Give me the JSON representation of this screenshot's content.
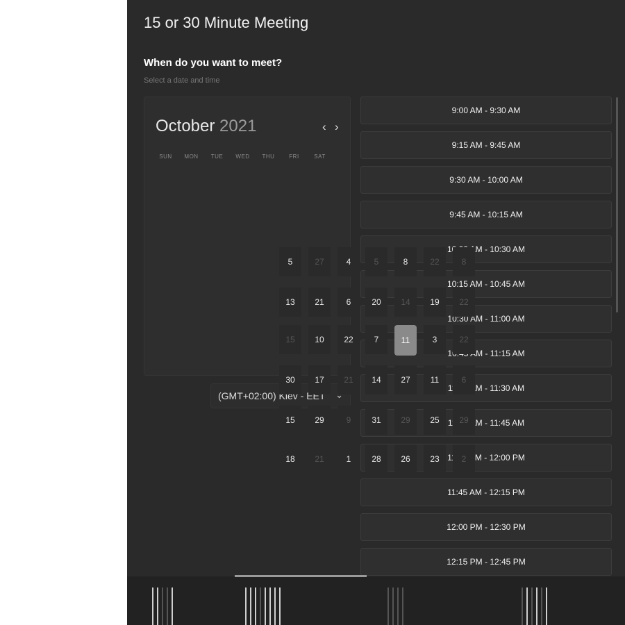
{
  "meeting": {
    "title": "15 or 30 Minute Meeting",
    "heading": "When do you want to meet?",
    "subheading": "Select a date and time"
  },
  "calendar": {
    "month": "October",
    "year": "2021",
    "prev_icon": "‹",
    "next_icon": "›",
    "weekdays": [
      "SUN",
      "MON",
      "TUE",
      "WED",
      "THU",
      "FRI",
      "SAT"
    ],
    "days": [
      {
        "label": "5",
        "dim": false
      },
      {
        "label": "27",
        "dim": true
      },
      {
        "label": "4",
        "dim": false
      },
      {
        "label": "5",
        "dim": true
      },
      {
        "label": "8",
        "dim": false
      },
      {
        "label": "22",
        "dim": true
      },
      {
        "label": "8",
        "dim": true
      },
      {
        "label": "13",
        "dim": false
      },
      {
        "label": "21",
        "dim": false
      },
      {
        "label": "6",
        "dim": false
      },
      {
        "label": "20",
        "dim": false
      },
      {
        "label": "14",
        "dim": true
      },
      {
        "label": "19",
        "dim": false
      },
      {
        "label": "22",
        "dim": true
      },
      {
        "label": "15",
        "dim": true
      },
      {
        "label": "10",
        "dim": false
      },
      {
        "label": "22",
        "dim": false
      },
      {
        "label": "7",
        "dim": false
      },
      {
        "label": "11",
        "dim": false,
        "selected": true
      },
      {
        "label": "3",
        "dim": false
      },
      {
        "label": "22",
        "dim": true
      },
      {
        "label": "30",
        "dim": false
      },
      {
        "label": "17",
        "dim": false
      },
      {
        "label": "21",
        "dim": true
      },
      {
        "label": "14",
        "dim": false
      },
      {
        "label": "27",
        "dim": false
      },
      {
        "label": "11",
        "dim": false
      },
      {
        "label": "6",
        "dim": true
      },
      {
        "label": "15",
        "dim": false
      },
      {
        "label": "29",
        "dim": false
      },
      {
        "label": "9",
        "dim": true
      },
      {
        "label": "31",
        "dim": false
      },
      {
        "label": "29",
        "dim": true
      },
      {
        "label": "25",
        "dim": false
      },
      {
        "label": "29",
        "dim": true
      },
      {
        "label": "18",
        "dim": false
      },
      {
        "label": "21",
        "dim": true
      },
      {
        "label": "1",
        "dim": false
      },
      {
        "label": "28",
        "dim": false
      },
      {
        "label": "26",
        "dim": false
      },
      {
        "label": "23",
        "dim": false
      },
      {
        "label": "2",
        "dim": true
      }
    ]
  },
  "timezone": {
    "label": "(GMT+02:00) Kiev - EET",
    "arrow_icon": "⌄"
  },
  "time_slots": [
    "9:00 AM - 9:30 AM",
    "9:15 AM - 9:45 AM",
    "9:30 AM - 10:00 AM",
    "9:45 AM - 10:15 AM",
    "10:00 AM - 10:30 AM",
    "10:15 AM - 10:45 AM",
    "10:30 AM - 11:00 AM",
    "10:45 AM - 11:15 AM",
    "11:00 AM - 11:30 AM",
    "11:15 AM - 11:45 AM",
    "11:30 AM - 12:00 PM",
    "11:45 AM - 12:15 PM",
    "12:00 PM - 12:30 PM",
    "12:15 PM - 12:45 PM"
  ],
  "colors": {
    "panel_bg": "#2a2a2a",
    "slot_bg": "#2f2f2f",
    "selected_day": "#8a8a8a"
  }
}
